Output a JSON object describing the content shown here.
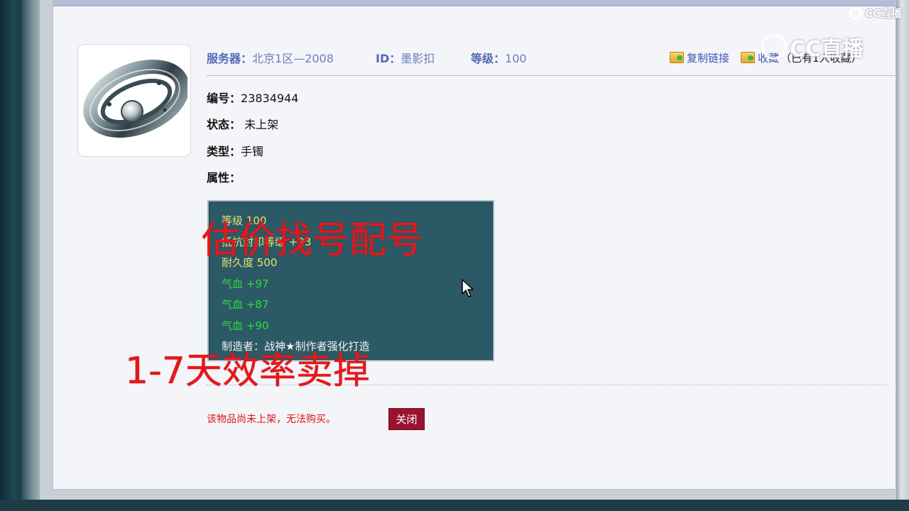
{
  "header": {
    "server_label": "服务器：",
    "server_value": "北京1区—2008",
    "id_label": "ID：",
    "id_value": "墨影扣",
    "level_label": "等级：",
    "level_value": "100"
  },
  "actions": {
    "copy_link": "复制链接",
    "favorite": "收藏",
    "favorite_note": "（已有1人收藏）"
  },
  "fields": {
    "number_label": "编号：",
    "number_value": "23834944",
    "status_label": "状态：",
    "status_value": "未上架",
    "type_label": "类型：",
    "type_value": "手镯",
    "attr_label": "属性："
  },
  "attributes": [
    {
      "text": "等级 100",
      "color": "yellow"
    },
    {
      "text": "抵抗封印等级 +23",
      "color": "yellow"
    },
    {
      "text": "耐久度 500",
      "color": "yellow"
    },
    {
      "text": "气血 +97",
      "color": "green"
    },
    {
      "text": "气血 +87",
      "color": "green"
    },
    {
      "text": "气血 +90",
      "color": "green"
    },
    {
      "text": "制造者：战神★制作者强化打造",
      "color": "white"
    }
  ],
  "overlay": {
    "line1": "估价找号配号",
    "line2": "1-7天效率卖掉"
  },
  "footer": {
    "notice": "该物品尚未上架，无法购买。",
    "close_label": "关闭"
  },
  "watermark": {
    "small": "CC直播",
    "big": "CC直播"
  },
  "colors": {
    "attr_yellow": "#e8e26a",
    "attr_green": "#2fdc3e",
    "attr_white": "#f2f2f2",
    "overlay_red": "#e8161b",
    "close_button": "#9b1230",
    "label_blue": "#5468b8"
  },
  "icons": {
    "copy_link": "folder-link-icon",
    "favorite": "folder-add-icon",
    "item": "bracelet-icon",
    "cursor": "mouse-pointer-icon"
  }
}
